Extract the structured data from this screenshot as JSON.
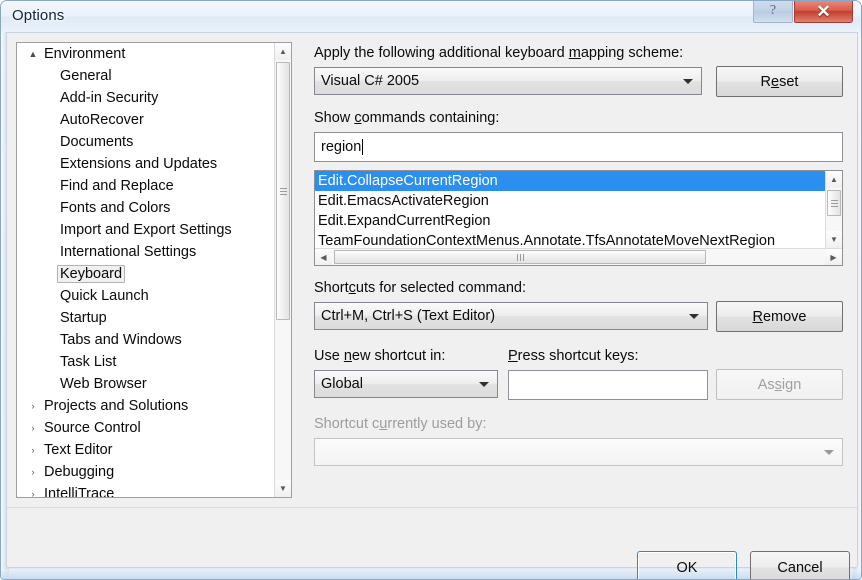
{
  "window": {
    "title": "Options",
    "help_glyph": "?",
    "close_glyph": "✕"
  },
  "tree": {
    "items": [
      {
        "label": "Environment",
        "depth": 0,
        "expander": "▲",
        "expanded": true,
        "selected": false
      },
      {
        "label": "General",
        "depth": 1,
        "expander": "",
        "selected": false
      },
      {
        "label": "Add-in Security",
        "depth": 1,
        "expander": "",
        "selected": false
      },
      {
        "label": "AutoRecover",
        "depth": 1,
        "expander": "",
        "selected": false
      },
      {
        "label": "Documents",
        "depth": 1,
        "expander": "",
        "selected": false
      },
      {
        "label": "Extensions and Updates",
        "depth": 1,
        "expander": "",
        "selected": false
      },
      {
        "label": "Find and Replace",
        "depth": 1,
        "expander": "",
        "selected": false
      },
      {
        "label": "Fonts and Colors",
        "depth": 1,
        "expander": "",
        "selected": false
      },
      {
        "label": "Import and Export Settings",
        "depth": 1,
        "expander": "",
        "selected": false
      },
      {
        "label": "International Settings",
        "depth": 1,
        "expander": "",
        "selected": false
      },
      {
        "label": "Keyboard",
        "depth": 1,
        "expander": "",
        "selected": true
      },
      {
        "label": "Quick Launch",
        "depth": 1,
        "expander": "",
        "selected": false
      },
      {
        "label": "Startup",
        "depth": 1,
        "expander": "",
        "selected": false
      },
      {
        "label": "Tabs and Windows",
        "depth": 1,
        "expander": "",
        "selected": false
      },
      {
        "label": "Task List",
        "depth": 1,
        "expander": "",
        "selected": false
      },
      {
        "label": "Web Browser",
        "depth": 1,
        "expander": "",
        "selected": false
      },
      {
        "label": "Projects and Solutions",
        "depth": 0,
        "expander": "›",
        "selected": false
      },
      {
        "label": "Source Control",
        "depth": 0,
        "expander": "›",
        "selected": false
      },
      {
        "label": "Text Editor",
        "depth": 0,
        "expander": "›",
        "selected": false
      },
      {
        "label": "Debugging",
        "depth": 0,
        "expander": "›",
        "selected": false
      },
      {
        "label": "IntelliTrace",
        "depth": 0,
        "expander": "›",
        "selected": false
      }
    ],
    "scroll_up_glyph": "▲",
    "scroll_down_glyph": "▼"
  },
  "panel": {
    "scheme_label_pre": "Apply the following additional keyboard ",
    "scheme_label_acc": "m",
    "scheme_label_post": "apping scheme:",
    "scheme_value": "Visual C# 2005",
    "reset_pre": "R",
    "reset_acc": "e",
    "reset_post": "set",
    "filter_label_pre": "Show ",
    "filter_label_acc": "c",
    "filter_label_post": "ommands containing:",
    "filter_value": "region",
    "commands": [
      {
        "label": "Edit.CollapseCurrentRegion",
        "selected": true
      },
      {
        "label": "Edit.EmacsActivateRegion",
        "selected": false
      },
      {
        "label": "Edit.ExpandCurrentRegion",
        "selected": false
      },
      {
        "label": "TeamFoundationContextMenus.Annotate.TfsAnnotateMoveNextRegion",
        "selected": false
      }
    ],
    "shortcuts_label_pre": "Short",
    "shortcuts_label_acc": "c",
    "shortcuts_label_post": "uts for selected command:",
    "shortcuts_value": "Ctrl+M, Ctrl+S (Text Editor)",
    "remove_pre": "",
    "remove_acc": "R",
    "remove_post": "emove",
    "usein_label_pre": "Use ",
    "usein_label_acc": "n",
    "usein_label_post": "ew shortcut in:",
    "usein_value": "Global",
    "presskeys_label_pre": "",
    "presskeys_label_acc": "P",
    "presskeys_label_post": "ress shortcut keys:",
    "presskeys_value": "",
    "assign_pre": "As",
    "assign_acc": "s",
    "assign_post": "ign",
    "usedby_label_pre": "Shortcut c",
    "usedby_label_acc": "u",
    "usedby_label_post": "rrently used by:",
    "usedby_value": "",
    "list_scroll_up_glyph": "▲",
    "list_scroll_down_glyph": "▼",
    "list_scroll_left_glyph": "◀",
    "list_scroll_right_glyph": "▶"
  },
  "footer": {
    "ok_label": "OK",
    "cancel_label": "Cancel"
  },
  "colors": {
    "selection_blue": "#2a8fef",
    "close_red": "#c33f2c",
    "default_button_border": "#2c86d6",
    "dialog_face": "#f0f0f0"
  }
}
